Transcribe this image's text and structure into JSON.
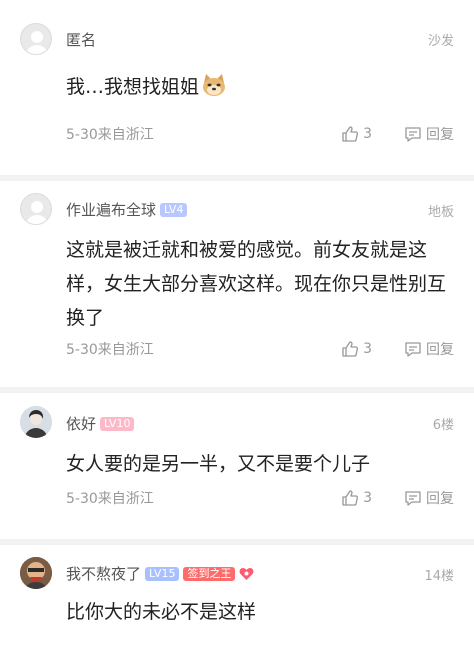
{
  "comments": [
    {
      "user": "匿名",
      "level": "",
      "floor": "沙发",
      "text": "我…我想找姐姐",
      "emoji": "doge",
      "meta": "5-30来自浙江",
      "likes": "3",
      "reply_label": "回复"
    },
    {
      "user": "作业遍布全球",
      "level": "LV4",
      "floor": "地板",
      "text": "这就是被迁就和被爱的感觉。前女友就是这样，女生大部分喜欢这样。现在你只是性别互换了",
      "meta": "5-30来自浙江",
      "likes": "3",
      "reply_label": "回复"
    },
    {
      "user": "依好",
      "level": "LV10",
      "floor": "6楼",
      "text": "女人要的是另一半，又不是要个儿子",
      "meta": "5-30来自浙江",
      "likes": "3",
      "reply_label": "回复"
    },
    {
      "user": "我不熬夜了",
      "level": "LV15",
      "title_badge": "签到之王",
      "floor": "14楼",
      "text": "比你大的未必不是这样"
    }
  ],
  "colors": {
    "background": "#ffffff",
    "divider": "#f2f2f2",
    "meta_text": "#999999",
    "title_badge": "#ff6a6a"
  },
  "icons": {
    "like": "thumbs-up-icon",
    "reply": "comment-bubble-icon",
    "heart": "heart-icon",
    "default_avatar": "default-avatar-icon"
  }
}
